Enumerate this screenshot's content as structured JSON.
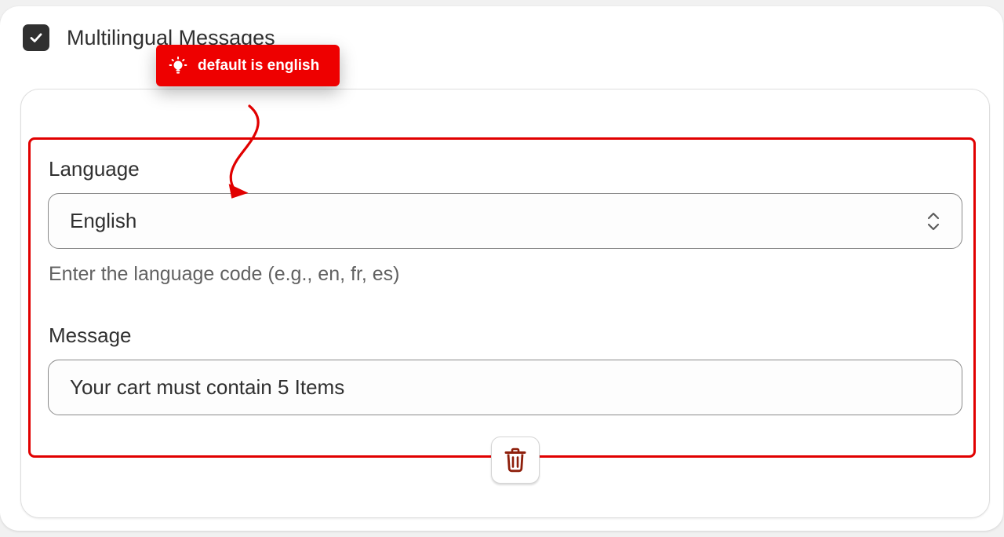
{
  "multilingual": {
    "checked": true,
    "label": "Multilingual Messages"
  },
  "tooltip": {
    "icon": "lightbulb-icon",
    "text": "default is english"
  },
  "language": {
    "label": "Language",
    "selected": "English",
    "help_text": "Enter the language code (e.g., en, fr, es)"
  },
  "message": {
    "label": "Message",
    "value": "Your cart must contain 5 Items"
  },
  "delete": {
    "icon": "trash-icon"
  },
  "colors": {
    "highlight": "#e10000",
    "tooltip_bg": "#ee0000",
    "checkbox_bg": "#303030",
    "trash": "#8e1f0b"
  }
}
